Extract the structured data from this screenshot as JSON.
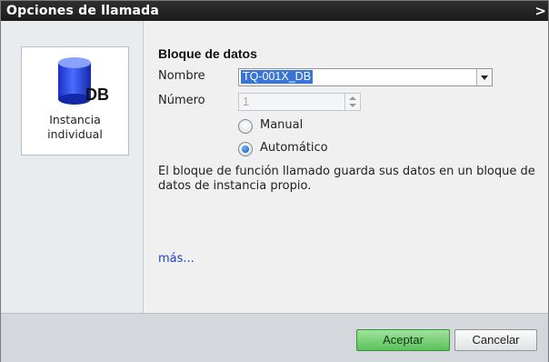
{
  "dialog": {
    "title": "Opciones de llamada",
    "title_arrow": ">"
  },
  "left": {
    "tile": {
      "icon": "database-icon",
      "icon_text": "DB",
      "caption_line1": "Instancia",
      "caption_line2": "individual"
    }
  },
  "form": {
    "section_title": "Bloque de datos",
    "name_label": "Nombre",
    "name_value": "TQ-001X_DB",
    "number_label": "Número",
    "number_value": "1",
    "radio_manual_label": "Manual",
    "radio_auto_label": "Automático",
    "selected": "Automático",
    "description": "El bloque de función llamado guarda sus datos en un bloque de datos de instancia propio.",
    "more_link": "más..."
  },
  "footer": {
    "ok_label": "Aceptar",
    "cancel_label": "Cancelar"
  },
  "colors": {
    "title_bg": "#1c1c1c",
    "selection": "#3875d7",
    "ok_button": "#5bc15a",
    "link": "#1f3fcf"
  }
}
